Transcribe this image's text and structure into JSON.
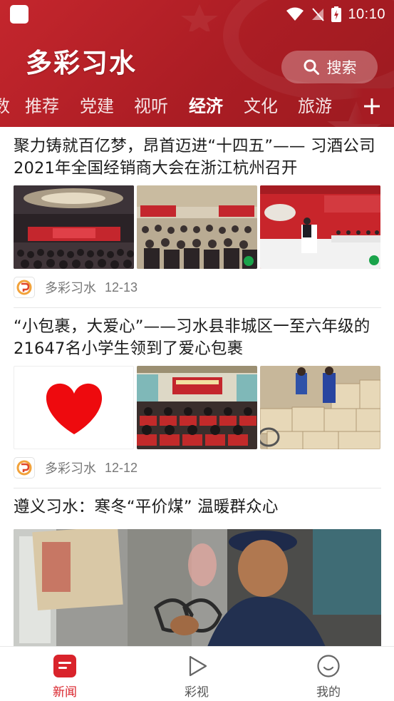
{
  "status_bar": {
    "time": "10:10"
  },
  "header": {
    "app_title": "多彩习水",
    "search_label": "搜索"
  },
  "tabs": [
    {
      "label": "数"
    },
    {
      "label": "推荐"
    },
    {
      "label": "党建"
    },
    {
      "label": "视听"
    },
    {
      "label": "经济",
      "active": true
    },
    {
      "label": "文化"
    },
    {
      "label": "旅游"
    }
  ],
  "articles": [
    {
      "title": "聚力铸就百亿梦，昂首迈进“十四五”—— 习酒公司2021年全国经销商大会在浙江杭州召开",
      "source": "多彩习水",
      "date": "12-13"
    },
    {
      "title": "“小包裹，大爱心”——习水县非城区一至六年级的21647名小学生领到了爱心包裹",
      "source": "多彩习水",
      "date": "12-12"
    },
    {
      "title": "遵义习水：寒冬“平价煤” 温暖群众心"
    }
  ],
  "bottom_nav": [
    {
      "label": "新闻",
      "icon": "news-icon",
      "active": true
    },
    {
      "label": "彩视",
      "icon": "play-icon"
    },
    {
      "label": "我的",
      "icon": "profile-icon"
    }
  ],
  "colors": {
    "brand_red": "#c4262d",
    "active_nav": "#d9232b"
  }
}
